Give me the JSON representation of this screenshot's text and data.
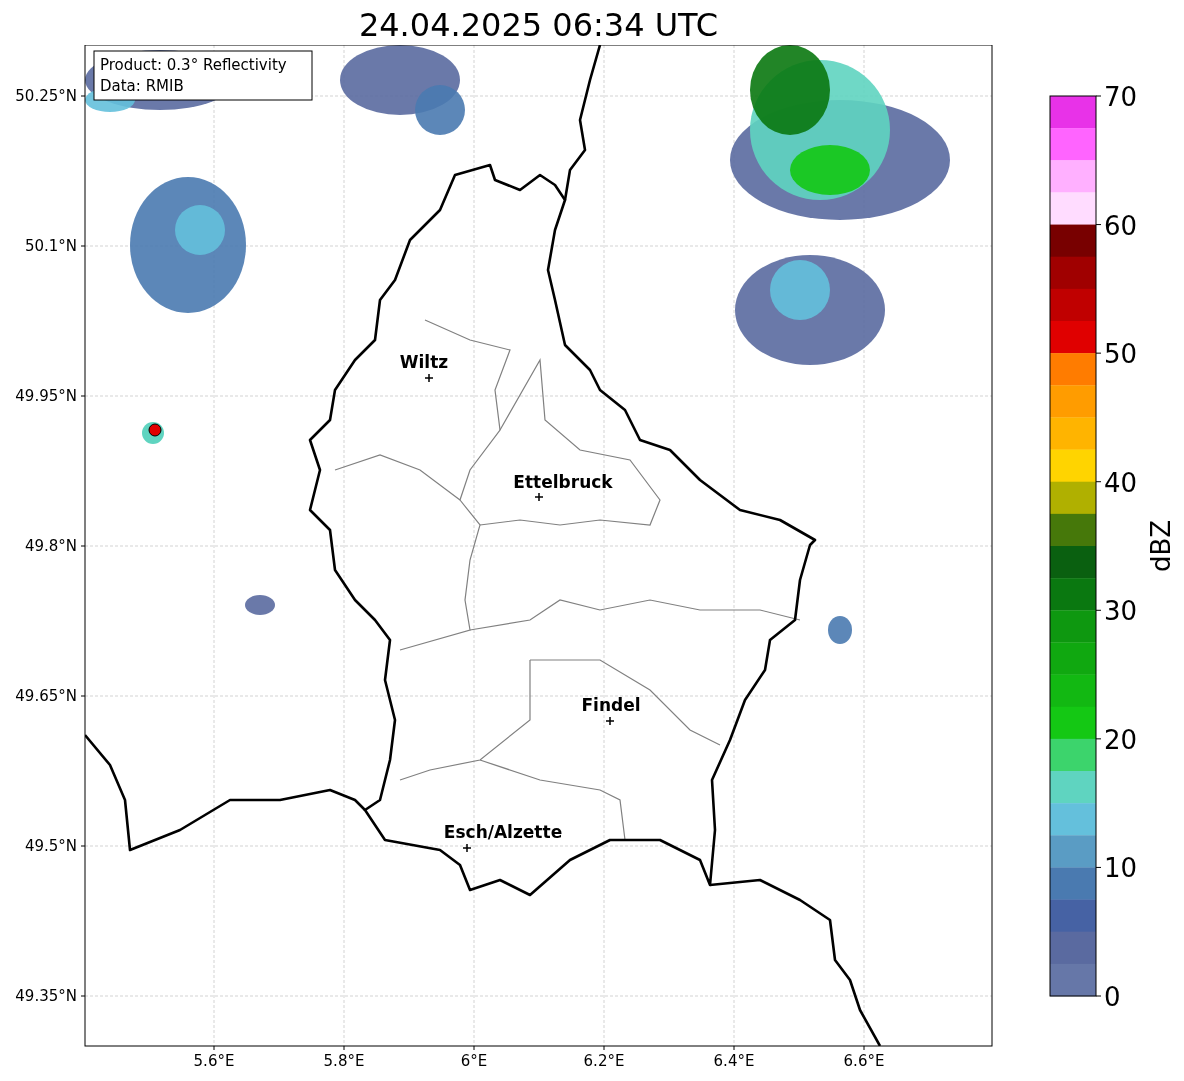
{
  "title": "24.04.2025 06:34 UTC",
  "info_box": [
    "Product: 0.3° Reflectivity",
    "Data: RMIB"
  ],
  "lat_labels": [
    "50.25°N",
    "50.1°N",
    "49.95°N",
    "49.8°N",
    "49.65°N",
    "49.5°N",
    "49.35°N"
  ],
  "lon_labels": [
    "5.6°E",
    "5.8°E",
    "6°E",
    "6.2°E",
    "6.4°E",
    "6.6°E"
  ],
  "cities": [
    {
      "name": "Wiltz"
    },
    {
      "name": "Ettelbruck"
    },
    {
      "name": "Findel"
    },
    {
      "name": "Esch/Alzette"
    }
  ],
  "colorbar": {
    "label": "dBZ",
    "ticks": [
      "70",
      "60",
      "50",
      "40",
      "30",
      "20",
      "10",
      "0"
    ],
    "segments": [
      {
        "color": "#e832e8"
      },
      {
        "color": "#ff64ff"
      },
      {
        "color": "#ffb0ff"
      },
      {
        "color": "#ffdcff"
      },
      {
        "color": "#780000"
      },
      {
        "color": "#a00000"
      },
      {
        "color": "#c00000"
      },
      {
        "color": "#e00000"
      },
      {
        "color": "#ff7c00"
      },
      {
        "color": "#ff9c00"
      },
      {
        "color": "#ffb400"
      },
      {
        "color": "#ffd400"
      },
      {
        "color": "#b0b000"
      },
      {
        "color": "#46780a"
      },
      {
        "color": "#0a6010"
      },
      {
        "color": "#0a7810"
      },
      {
        "color": "#0e9810"
      },
      {
        "color": "#10a810"
      },
      {
        "color": "#12b812"
      },
      {
        "color": "#14c814"
      },
      {
        "color": "#3cd46c"
      },
      {
        "color": "#5fd4c0"
      },
      {
        "color": "#64c0dc"
      },
      {
        "color": "#5a9cc4"
      },
      {
        "color": "#4a7ab0"
      },
      {
        "color": "#4662a4"
      },
      {
        "color": "#5a6aa0"
      },
      {
        "color": "#6677a8"
      }
    ]
  }
}
